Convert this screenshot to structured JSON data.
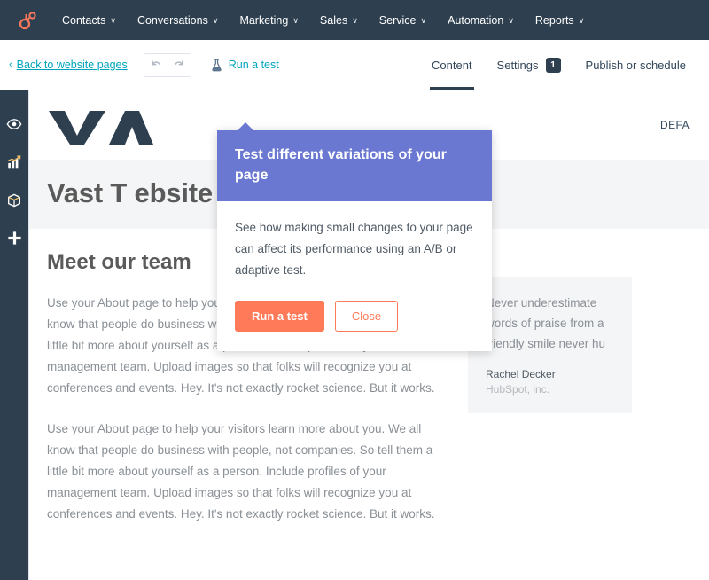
{
  "topnav": {
    "logo_icon": "hubspot-sprocket-icon",
    "items": [
      {
        "label": "Contacts",
        "caret": "∨"
      },
      {
        "label": "Conversations",
        "caret": "∨"
      },
      {
        "label": "Marketing",
        "caret": "∨"
      },
      {
        "label": "Sales",
        "caret": "∨"
      },
      {
        "label": "Service",
        "caret": "∨"
      },
      {
        "label": "Automation",
        "caret": "∨"
      },
      {
        "label": "Reports",
        "caret": "∨"
      }
    ]
  },
  "toolbar": {
    "back_chevron": "‹",
    "back_label": "Back to website pages",
    "undo_icon": "undo-arrow-icon",
    "redo_icon": "redo-arrow-icon",
    "run_test_label": "Run a test",
    "run_test_icon": "flask-icon",
    "tabs": [
      {
        "label": "Content",
        "badge": "",
        "active": true
      },
      {
        "label": "Settings",
        "badge": "1",
        "active": false
      },
      {
        "label": "Publish or schedule",
        "badge": "",
        "active": false
      }
    ]
  },
  "rail": {
    "items": [
      {
        "icon": "eye-icon",
        "name": "preview"
      },
      {
        "icon": "bar-chart-icon",
        "name": "analytics"
      },
      {
        "icon": "box-icon",
        "name": "modules"
      },
      {
        "icon": "plus-icon",
        "name": "add"
      }
    ]
  },
  "preview": {
    "site_logo_text": "VA",
    "site_nav_text": "DEFA",
    "hero_title": "Vast T                    ebsite Page",
    "section_heading": "Meet our team",
    "paragraph_1": "Use your About page to help your visitors learn more about you. We all know that people do business with people, not companies. So tell them a little bit more about yourself as a person. Include profiles of your management team. Upload images so that folks will recognize you at conferences and events. Hey. It's not exactly rocket science. But it works.",
    "paragraph_2": "Use your About page to help your visitors learn more about you. We all know that people do business with people, not companies. So tell them a little bit more about yourself as a person. Include profiles of your management team. Upload images so that folks will recognize you at conferences and events. Hey. It's not exactly rocket science. But it works.",
    "quote": {
      "text_line_1": "Never underestimate",
      "text_line_2": "words of praise from a",
      "text_line_3": "friendly smile never hu",
      "author": "Rachel Decker",
      "company": "HubSpot, inc."
    }
  },
  "popover": {
    "title": "Test different variations of your page",
    "body": "See how making small changes to your page can affect its performance using an A/B or adaptive test.",
    "primary_button": "Run a test",
    "secondary_button": "Close"
  },
  "colors": {
    "nav_dark": "#2e3f50",
    "teal_link": "#00a4bd",
    "popover_purple": "#6a78d1",
    "orange": "#ff7a59",
    "hero_gray": "#f4f5f6"
  }
}
